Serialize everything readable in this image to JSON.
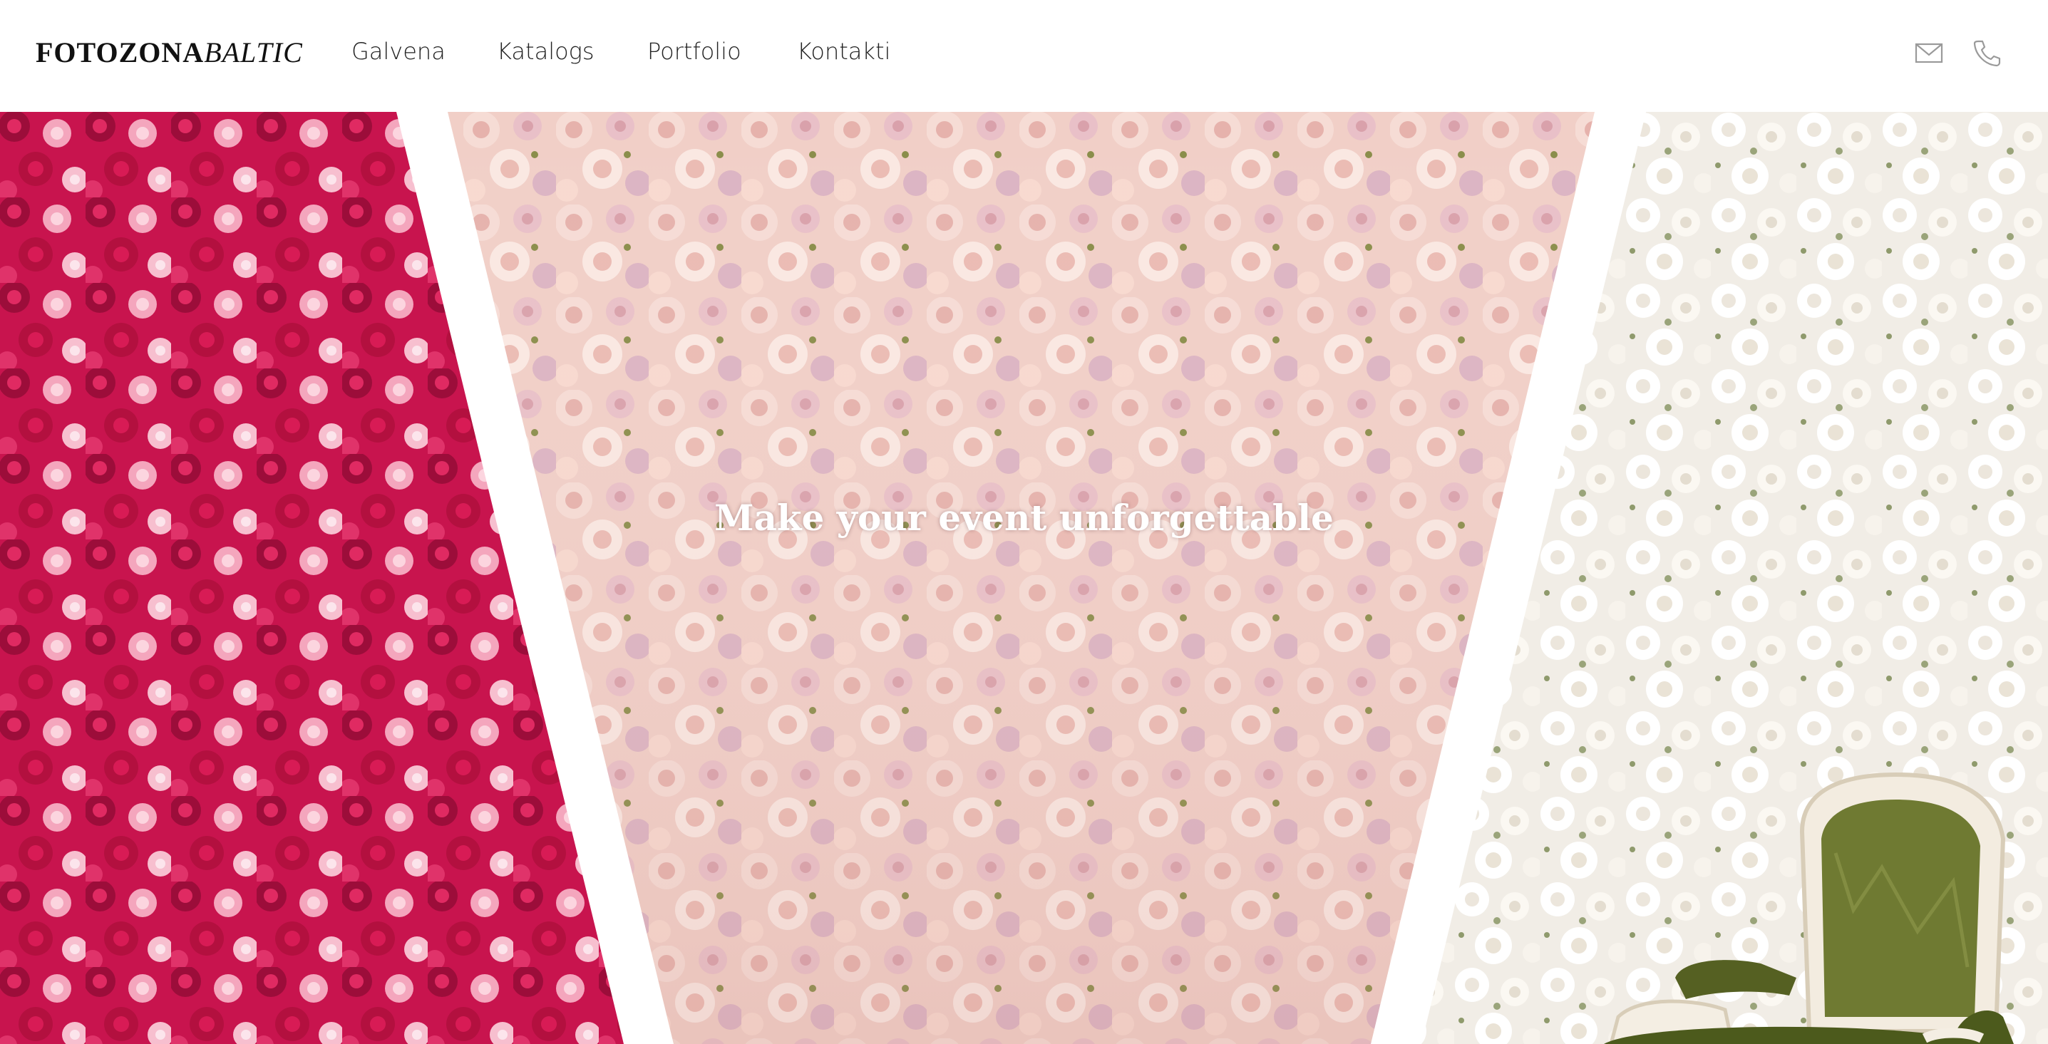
{
  "header": {
    "logo_bold": "FOTOZONA",
    "logo_italic": "BALTIC",
    "nav": [
      {
        "label": "Galvena"
      },
      {
        "label": "Katalogs"
      },
      {
        "label": "Portfolio"
      },
      {
        "label": "Kontakti"
      }
    ],
    "icons": [
      "mail-icon",
      "phone-icon"
    ]
  },
  "hero": {
    "headline": "Make your event unforgettable",
    "panels": [
      {
        "name": "red-pink-flower-wall",
        "colors": [
          "#c8144e",
          "#f4a6bd",
          "#9c0d3a"
        ]
      },
      {
        "name": "blush-flower-wall",
        "colors": [
          "#f2d2cc",
          "#e8b8b2",
          "#fbe9e3"
        ]
      },
      {
        "name": "white-flower-wall",
        "colors": [
          "#f6f2ec",
          "#ffffff",
          "#dcdccc"
        ]
      }
    ],
    "chair_color": "#6f7a32"
  },
  "colors": {
    "header_bg": "#ffffff",
    "text": "#222222",
    "icon": "#9a9a9a"
  }
}
